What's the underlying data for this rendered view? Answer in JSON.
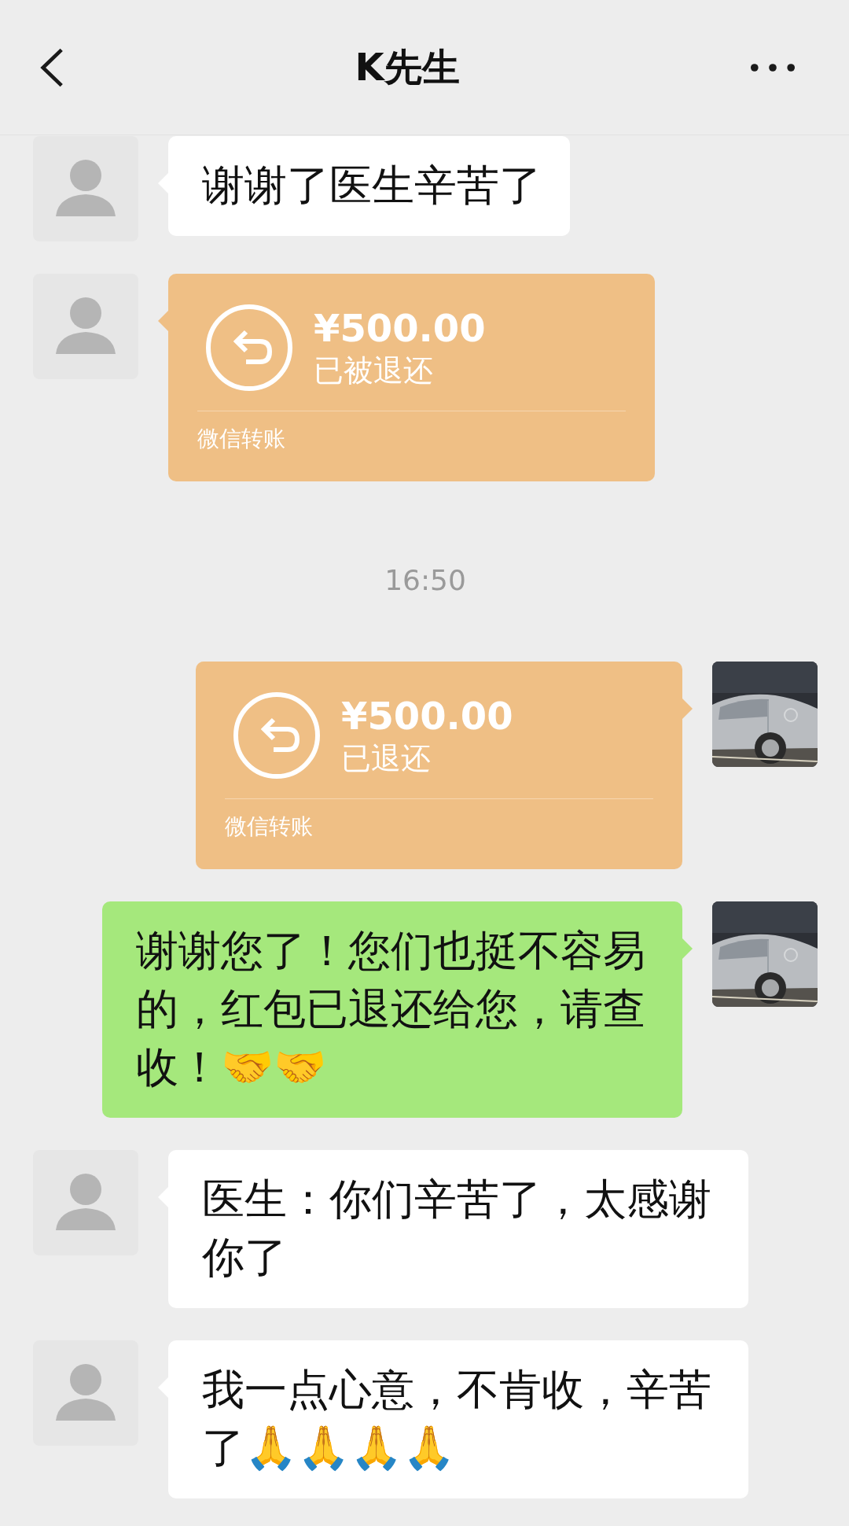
{
  "header": {
    "title": "K先生"
  },
  "messages": [
    {
      "kind": "text",
      "outgoing": false,
      "text": "谢谢了医生辛苦了"
    },
    {
      "kind": "transfer",
      "outgoing": false,
      "amount": "¥500.00",
      "status": "已被退还",
      "label": "微信转账"
    },
    {
      "kind": "time",
      "text": "16:50"
    },
    {
      "kind": "transfer",
      "outgoing": true,
      "amount": "¥500.00",
      "status": "已退还",
      "label": "微信转账"
    },
    {
      "kind": "text",
      "outgoing": true,
      "text": "谢谢您了！您们也挺不容易的，红包已退还给您，请查收！🤝🤝"
    },
    {
      "kind": "text",
      "outgoing": false,
      "text": "医生：你们辛苦了，太感谢你了"
    },
    {
      "kind": "text",
      "outgoing": false,
      "text": "我一点心意，不肯收，辛苦了🙏🙏🙏🙏"
    }
  ]
}
